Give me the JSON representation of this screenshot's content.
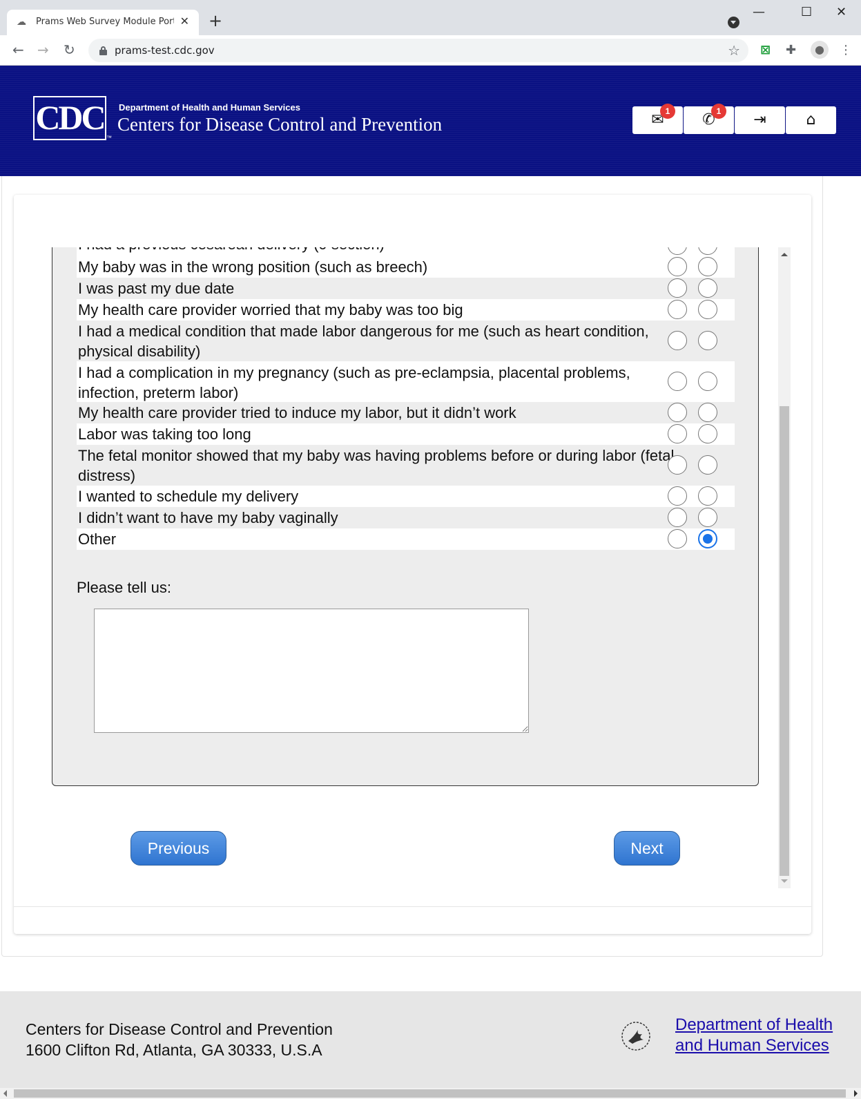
{
  "browser": {
    "tab_title": "Prams Web Survey Module Portal",
    "tab_close": "✕",
    "new_tab": "+",
    "url": "prams-test.cdc.gov",
    "window_controls": {
      "minimize": "—",
      "maximize": "☐",
      "close": "✕"
    },
    "nav": {
      "back": "←",
      "forward": "→",
      "reload": "↻"
    }
  },
  "header": {
    "logo_text": "CDC",
    "logo_tm": "™",
    "department": "Department of Health and Human Services",
    "agency": "Centers for Disease Control and Prevention",
    "buttons": [
      {
        "icon": "mail-icon",
        "glyph": "✉",
        "badge": "1"
      },
      {
        "icon": "phone-icon",
        "glyph": "✆",
        "badge": "1"
      },
      {
        "icon": "sign-in-icon",
        "glyph": "⇥",
        "badge": ""
      },
      {
        "icon": "home-icon",
        "glyph": "⌂",
        "badge": ""
      }
    ]
  },
  "survey": {
    "options": [
      {
        "label": "I had a previous cesarean delivery (c-section)",
        "selected": ""
      },
      {
        "label": "My baby was in the wrong position (such as breech)",
        "selected": ""
      },
      {
        "label": "I was past my due date",
        "selected": ""
      },
      {
        "label": "My health care provider worried that my baby was too big",
        "selected": ""
      },
      {
        "label": "I had a medical condition that made labor dangerous for me (such as heart condition, physical disability)",
        "selected": ""
      },
      {
        "label": "I had a complication in my pregnancy (such as pre-eclampsia, placental problems, infection, preterm labor)",
        "selected": ""
      },
      {
        "label": "My health care provider tried to induce my labor, but it didn’t work",
        "selected": ""
      },
      {
        "label": "Labor was taking too long",
        "selected": ""
      },
      {
        "label": "The fetal monitor showed that my baby was having problems before or during labor (fetal distress)",
        "selected": ""
      },
      {
        "label": "I wanted to schedule my delivery",
        "selected": ""
      },
      {
        "label": "I didn’t want to have my baby vaginally",
        "selected": ""
      },
      {
        "label": "Other",
        "selected": "second"
      }
    ],
    "tell_us_label": "Please tell us:",
    "tell_us_value": "",
    "previous_label": "Previous",
    "next_label": "Next"
  },
  "footer": {
    "org": "Centers for Disease Control and Prevention",
    "address": "1600 Clifton Rd, Atlanta, GA 30333, U.S.A",
    "hhs_link_line1": "Department of Health",
    "hhs_link_line2": "and Human Services"
  },
  "colors": {
    "header_bg": "#0a1183",
    "radio_selected": "#1a73e8",
    "button_gradient_top": "#5d9be6",
    "button_gradient_bottom": "#2f74d0",
    "badge": "#e53935"
  }
}
